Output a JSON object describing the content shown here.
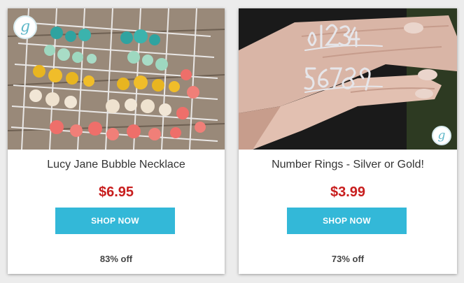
{
  "products": [
    {
      "title": "Lucy Jane Bubble Necklace",
      "price": "$6.95",
      "button_label": "SHOP NOW",
      "discount": "83% off",
      "brand_mark": "g"
    },
    {
      "title": "Number Rings - Silver or Gold!",
      "price": "$3.99",
      "button_label": "SHOP NOW",
      "discount": "73% off",
      "brand_mark": "g"
    }
  ],
  "colors": {
    "price": "#c81e1e",
    "button": "#33b8d8",
    "brand": "#5fb8c9"
  },
  "icons": [
    "brand-logo-icon"
  ]
}
